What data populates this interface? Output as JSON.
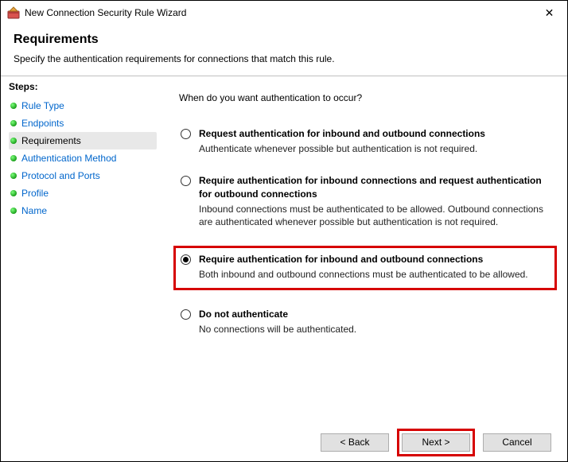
{
  "window": {
    "title": "New Connection Security Rule Wizard",
    "close_glyph": "✕"
  },
  "header": {
    "title": "Requirements",
    "subtitle": "Specify the authentication requirements for connections that match this rule."
  },
  "steps": {
    "label": "Steps:",
    "items": [
      {
        "label": "Rule Type"
      },
      {
        "label": "Endpoints"
      },
      {
        "label": "Requirements"
      },
      {
        "label": "Authentication Method"
      },
      {
        "label": "Protocol and Ports"
      },
      {
        "label": "Profile"
      },
      {
        "label": "Name"
      }
    ]
  },
  "content": {
    "prompt": "When do you want authentication to occur?",
    "options": [
      {
        "title": "Request authentication for inbound and outbound connections",
        "desc": "Authenticate whenever possible but authentication is not required.",
        "checked": false
      },
      {
        "title": "Require authentication for inbound connections and request authentication for outbound connections",
        "desc": "Inbound connections must be authenticated to be allowed. Outbound connections are authenticated whenever possible but authentication is not required.",
        "checked": false
      },
      {
        "title": "Require authentication for inbound and outbound connections",
        "desc": "Both inbound and outbound connections must be authenticated to be allowed.",
        "checked": true
      },
      {
        "title": "Do not authenticate",
        "desc": "No connections will be authenticated.",
        "checked": false
      }
    ]
  },
  "footer": {
    "back": "< Back",
    "next": "Next >",
    "cancel": "Cancel"
  }
}
